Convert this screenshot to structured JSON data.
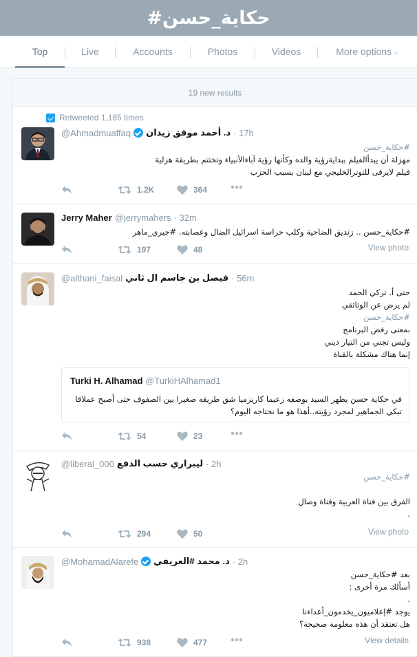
{
  "page_title": "#حكاية_حسن",
  "tabs": [
    {
      "label": "Top",
      "active": true
    },
    {
      "label": "Live"
    },
    {
      "label": "Accounts"
    },
    {
      "label": "Photos"
    },
    {
      "label": "Videos"
    },
    {
      "label": "More options"
    }
  ],
  "new_results": "19 new results",
  "tweets": [
    {
      "retweet_label": "Retweeted 1,185 times",
      "fullname": "د. أحمد موفق زيدان",
      "handle": "@Ahmadmuaffaq",
      "verified": true,
      "time": "· 17h",
      "lines": [
        "#حكاية_حسن",
        "مهزلة أن يبدأالفيلم ببدايةرؤية والده وكأنها رؤية آباءالأنبياء وتختتم بطريقة هزلية",
        "فيلم لايرقى للتوترالخليجي مع لبنان بسبب الحزب"
      ],
      "retweets": "1.2K",
      "likes": "364"
    },
    {
      "fullname": "Jerry Maher",
      "handle": "@jerrymahers",
      "time": "· 32m",
      "lines": [
        "#حكاية_حسن .. زنديق الضاحية وكلب حراسة اسرائيل الضال وعصابته. #جيري_ماهر"
      ],
      "retweets": "197",
      "likes": "48",
      "link": "View photo"
    },
    {
      "fullname": "فيصل بن جاسم ال ثاني",
      "handle": "@althani_faisal",
      "time": "· 56m",
      "lines": [
        "حتى أ. تركي الحمد",
        "لم يرض عن الوثائقي",
        "#حكاية_حسن",
        "بمعنى رفض البرنامج",
        "وليس تجني من التيار ديني",
        "إنما هناك مشكلة بالقناة"
      ],
      "quote": {
        "fullname": "Turki H. Alhamad",
        "handle": "@TurkiHAlhamad1",
        "lines": [
          "في حكاية حسن يظهر السيد بوصفه زعيما كاريزميا شق طريقه صغيرا بين الصفوف حتى أصبح عملاقا",
          "تبكي الجماهير لمجرد رؤيته..أهذا هو ما نحتاجه اليوم؟"
        ]
      },
      "retweets": "54",
      "likes": "23"
    },
    {
      "fullname": "ليبراري حسب الدفع",
      "handle": "@liberal_000",
      "time": "· 2h",
      "lines": [
        "#حكاية_حسن",
        "",
        "الفرق بين قناة العربية وقناة وصال",
        "."
      ],
      "retweets": "294",
      "likes": "50",
      "link": "View photo"
    },
    {
      "fullname": "د. محمد #العريفي",
      "handle": "@MohamadAlarefe",
      "verified": true,
      "time": "· 2h",
      "lines": [
        "بعد #حكاية_حسن",
        "أسألك مرة أخرى :",
        ".",
        "يوجد #إعلاميون_يخدمون_أعداءنا",
        "هل تعتقد أن هذه معلومة صحيحة؟"
      ],
      "retweets": "938",
      "likes": "477",
      "link": "View details"
    }
  ],
  "colors": {
    "header_bg": "#9aa9b4",
    "muted": "#8899a6",
    "verified": "#1da1f2"
  },
  "icons": [
    "reply-icon",
    "retweet-icon",
    "heart-icon",
    "more-icon",
    "verified-icon",
    "retweet-badge-icon"
  ]
}
